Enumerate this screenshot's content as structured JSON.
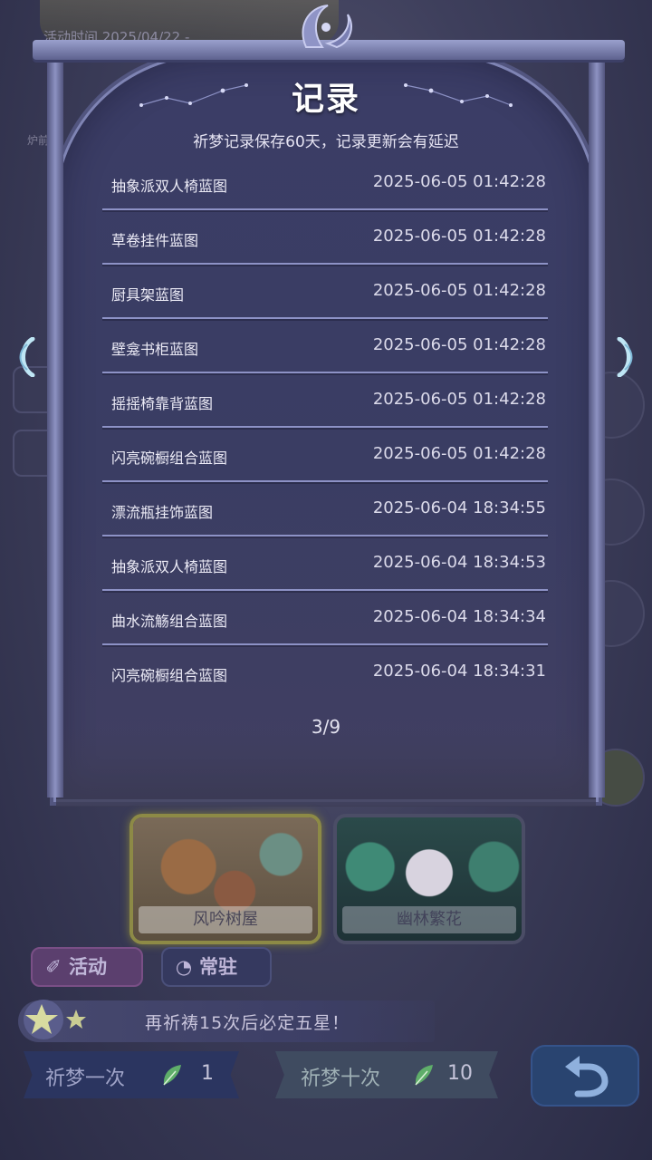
{
  "background": {
    "activity_time": "活动时间 2025/04/22 -",
    "left_hint": "炉前"
  },
  "modal": {
    "title": "记录",
    "subtitle": "祈梦记录保存60天，记录更新会有延迟",
    "records": [
      {
        "name": "抽象派双人椅蓝图",
        "time": "2025-06-05 01:42:28"
      },
      {
        "name": "草卷挂件蓝图",
        "time": "2025-06-05 01:42:28"
      },
      {
        "name": "厨具架蓝图",
        "time": "2025-06-05 01:42:28"
      },
      {
        "name": "壁龛书柜蓝图",
        "time": "2025-06-05 01:42:28"
      },
      {
        "name": "摇摇椅靠背蓝图",
        "time": "2025-06-05 01:42:28"
      },
      {
        "name": "闪亮碗橱组合蓝图",
        "time": "2025-06-05 01:42:28"
      },
      {
        "name": "漂流瓶挂饰蓝图",
        "time": "2025-06-04 18:34:55"
      },
      {
        "name": "抽象派双人椅蓝图",
        "time": "2025-06-04 18:34:53"
      },
      {
        "name": "曲水流觞组合蓝图",
        "time": "2025-06-04 18:34:34"
      },
      {
        "name": "闪亮碗橱组合蓝图",
        "time": "2025-06-04 18:34:31"
      }
    ],
    "page_indicator": "3/9",
    "prev_icon": "chevron-left-icon",
    "next_icon": "chevron-right-icon"
  },
  "banners": [
    {
      "label": "风吟树屋",
      "selected": true
    },
    {
      "label": "幽林繁花",
      "selected": false
    }
  ],
  "tabs": {
    "activity": "活动",
    "resident": "常驻"
  },
  "pity": {
    "text": "再祈祷15次后必定五星！"
  },
  "pray": {
    "one_label": "祈梦一次",
    "one_cost": "1",
    "ten_label": "祈梦十次",
    "ten_cost": "10",
    "currency_icon": "feather-icon"
  },
  "back_icon": "back-arrow-icon",
  "colors": {
    "modal_bg": "#3b3d66",
    "divider": "#8d92c6",
    "title": "#ffffff"
  }
}
